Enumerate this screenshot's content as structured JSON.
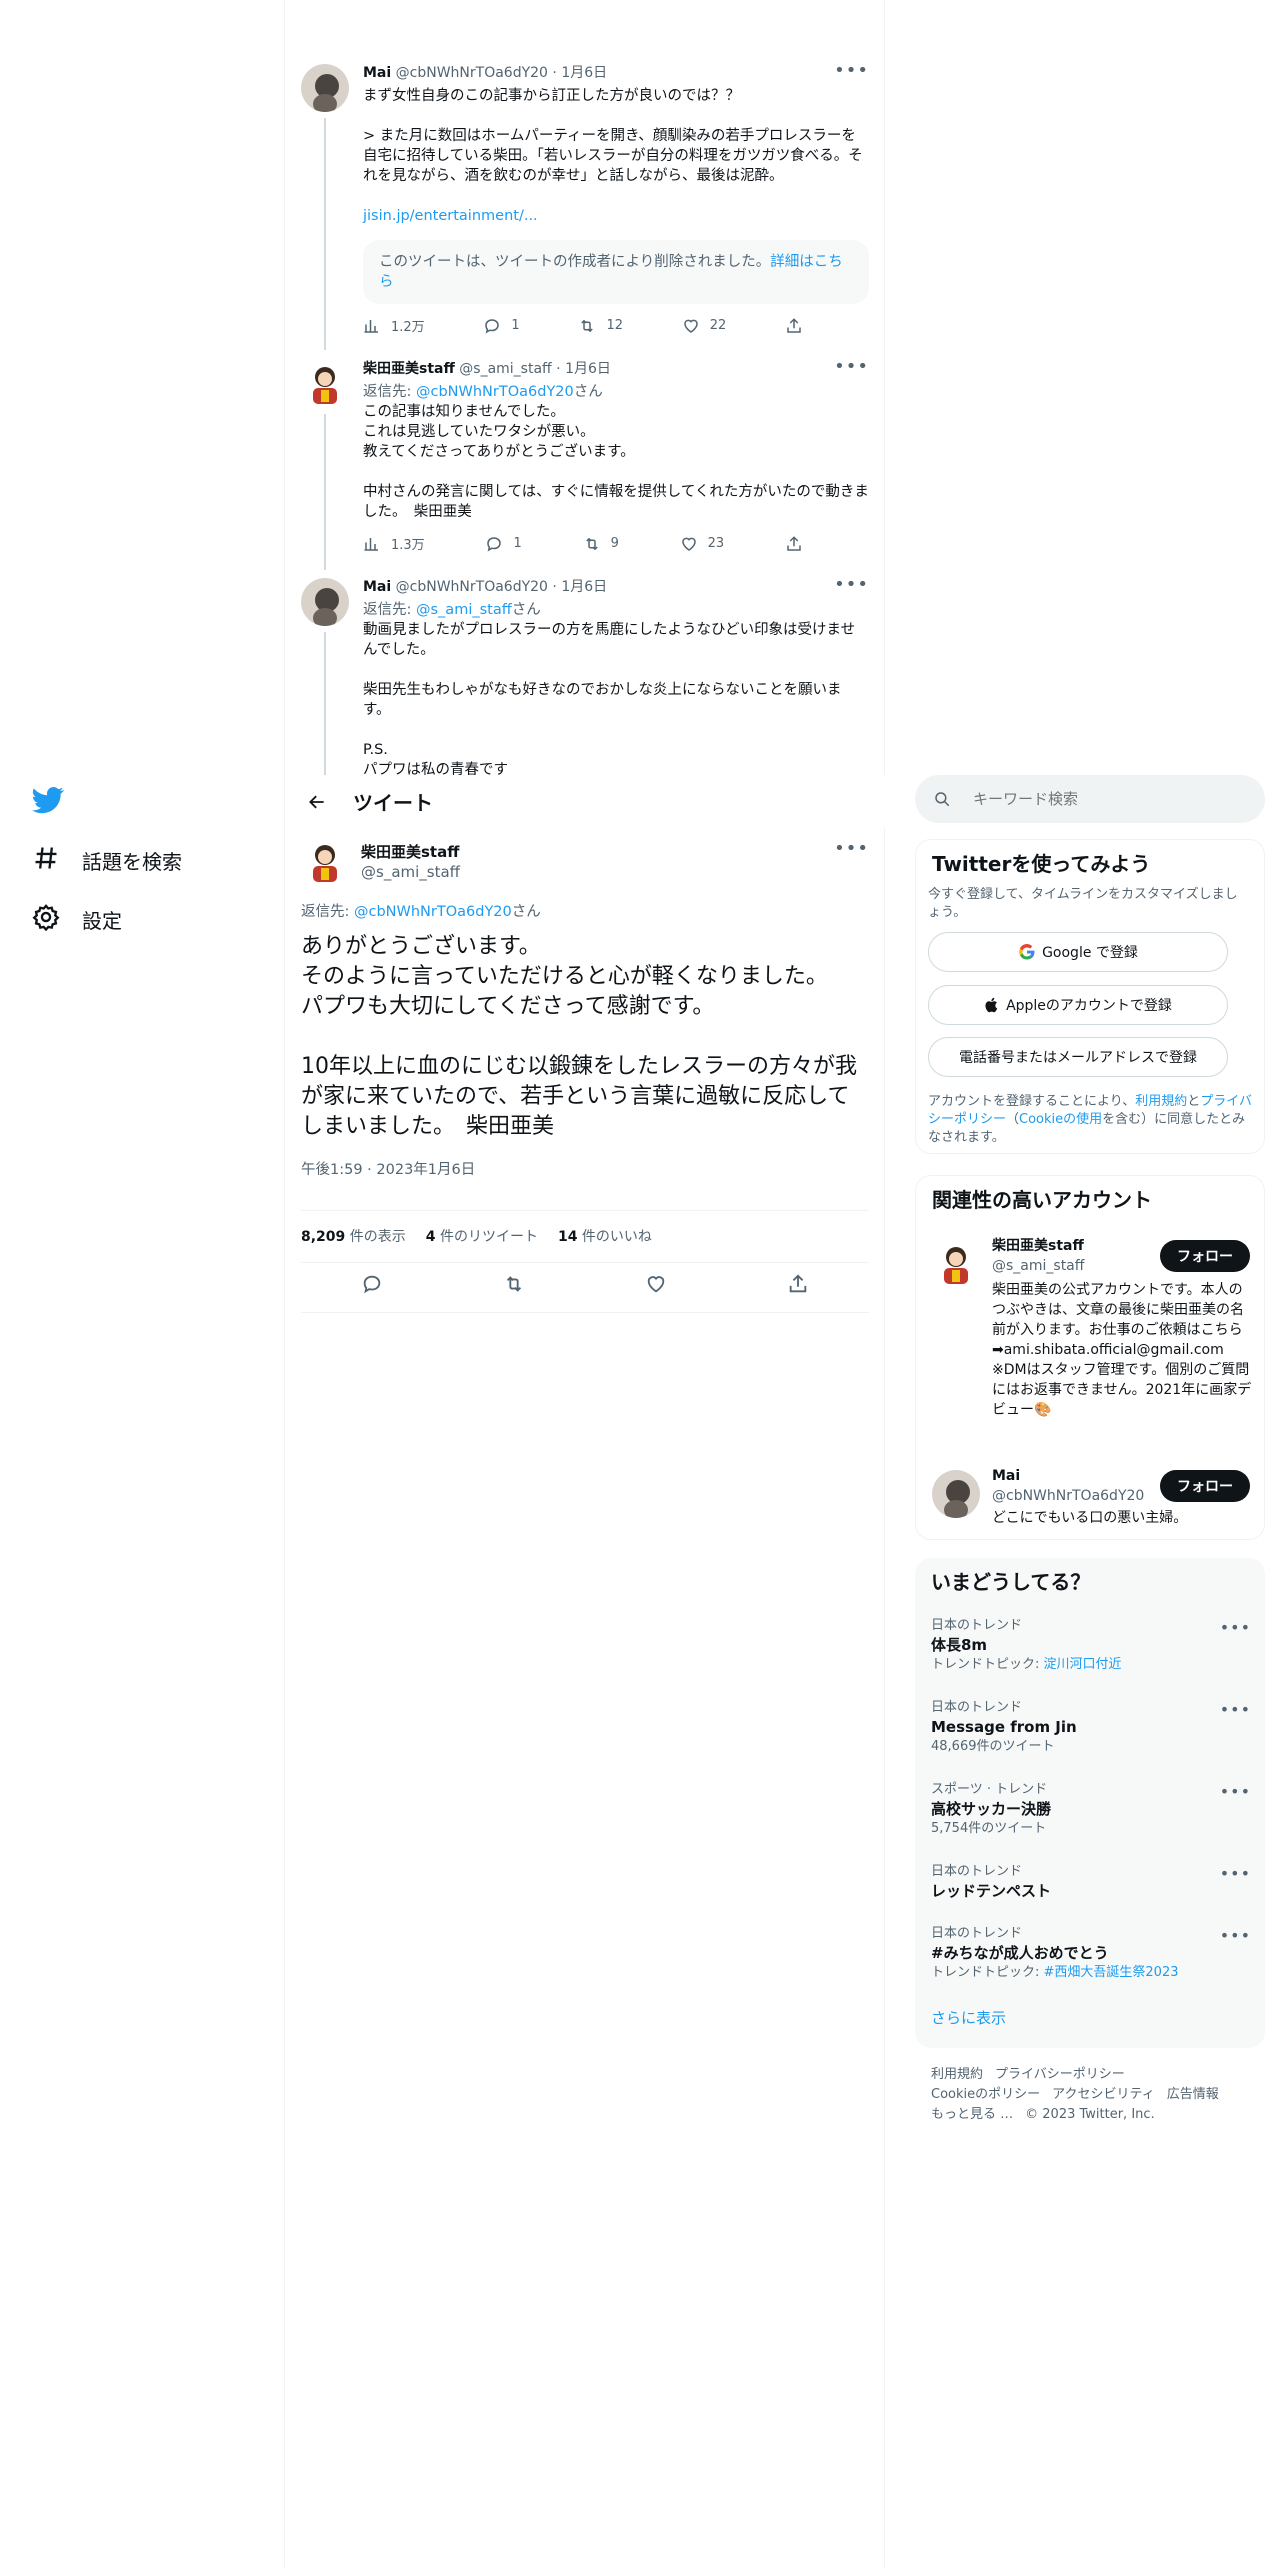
{
  "nav": {
    "items": [
      {
        "icon": "hashtag-icon",
        "label": "話題を検索"
      },
      {
        "icon": "gear-icon",
        "label": "設定"
      }
    ]
  },
  "context": {
    "tweet1": {
      "name": "Mai",
      "handle": "@cbNWhNrTOa6dY20",
      "date": "1月6日",
      "text": "まず女性自身のこの記事から訂正した方が良いのでは？？\n\n> また月に数回はホームパーティーを開き、顔馴染みの若手プロレスラーを自宅に招待している柴田。「若いレスラーが自分の料理をガツガツ食べる。それを見ながら、酒を飲むのが幸せ」と話しながら、最後は泥酔。",
      "link": "jisin.jp/entertainment/...",
      "notice": "このツイートは、ツイートの作成者により削除されました。",
      "notice_link": "詳細はこちら",
      "views": "1.2万",
      "replies": "1",
      "retweets": "12",
      "likes": "22"
    },
    "tweet2": {
      "name": "柴田亜美staff",
      "handle": "@s_ami_staff",
      "date": "1月6日",
      "reply_prefix": "返信先: ",
      "reply_to": "@cbNWhNrTOa6dY20",
      "reply_suffix": "さん",
      "text": "この記事は知りませんでした。\nこれは見逃していたワタシが悪い。\n教えてくださってありがとうございます。\n\n中村さんの発言に関しては、すぐに情報を提供してくれた方がいたので動きました。　柴田亜美",
      "views": "1.3万",
      "replies": "1",
      "retweets": "9",
      "likes": "23"
    },
    "tweet3": {
      "name": "Mai",
      "handle": "@cbNWhNrTOa6dY20",
      "date": "1月6日",
      "reply_prefix": "返信先: ",
      "reply_to": "@s_ami_staff",
      "reply_suffix": "さん",
      "text": "動画見ましたがプロレスラーの方を馬鹿にしたようなひどい印象は受けませんでした。\n\n柴田先生もわしゃがなも好きなのでおかしな炎上にならないことを願います。\n\nP.S.\nパプワは私の青春です"
    }
  },
  "header": {
    "title": "ツイート"
  },
  "main_tweet": {
    "name": "柴田亜美staff",
    "handle": "@s_ami_staff",
    "reply_prefix": "返信先: ",
    "reply_to": "@cbNWhNrTOa6dY20",
    "reply_suffix": "さん",
    "text": "ありがとうございます。\nそのように言っていただけると心が軽くなりました。\nパプワも大切にしてくださって感謝です。\n\n10年以上に血のにじむ以鍛錬をしたレスラーの方々が我が家に来ていたので、若手という言葉に過敏に反応してしまいました。　柴田亜美",
    "timestamp": "午後1:59 · 2023年1月6日",
    "views_count": "8,209",
    "views_label": "件の表示",
    "retweets_count": "4",
    "retweets_label": "件のリツイート",
    "likes_count": "14",
    "likes_label": "件のいいね"
  },
  "search": {
    "placeholder": "キーワード検索"
  },
  "signup": {
    "title": "Twitterを使ってみよう",
    "desc": "今すぐ登録して、タイムラインをカスタマイズしましょう。",
    "google": "Google で登録",
    "apple": "Appleのアカウントで登録",
    "phone": "電話番号またはメールアドレスで登録",
    "terms_1": "アカウントを登録することにより、",
    "terms_link1": "利用規約",
    "terms_2": "と",
    "terms_link2": "プライバシーポリシー",
    "terms_3": "（",
    "terms_link3": "Cookieの使用",
    "terms_4": "を含む）に同意したとみなされます。"
  },
  "related": {
    "title": "関連性の高いアカウント",
    "follow_label": "フォロー",
    "accounts": [
      {
        "name": "柴田亜美staff",
        "handle": "@s_ami_staff",
        "bio": "柴田亜美の公式アカウントです。本人のつぶやきは、文章の最後に柴田亜美の名前が入ります。お仕事のご依頼はこちら\n➡ami.shibata.official@gmail.com\n※DMはスタッフ管理です。個別のご質問にはお返事できません。2021年に画家デビュー🎨"
      },
      {
        "name": "Mai",
        "handle": "@cbNWhNrTOa6dY20",
        "bio": "どこにでもいる口の悪い主婦。"
      }
    ]
  },
  "trends": {
    "title": "いまどうしてる？",
    "items": [
      {
        "category": "日本のトレンド",
        "name": "体長8m",
        "sub_prefix": "トレンドトピック: ",
        "sub_link": "淀川河口付近"
      },
      {
        "category": "日本のトレンド",
        "name": "Message from Jin",
        "sub": "48,669件のツイート"
      },
      {
        "category": "スポーツ · トレンド",
        "name": "高校サッカー決勝",
        "sub": "5,754件のツイート"
      },
      {
        "category": "日本のトレンド",
        "name": "レッドテンペスト"
      },
      {
        "category": "日本のトレンド",
        "name": "#みちなが成人おめでとう",
        "sub_prefix": "トレンドトピック: ",
        "sub_link": "#西畑大吾誕生祭2023"
      }
    ],
    "more": "さらに表示"
  },
  "footer": {
    "line1": [
      "利用規約",
      "プライバシーポリシー"
    ],
    "line2": [
      "Cookieのポリシー",
      "アクセシビリティ",
      "広告情報"
    ],
    "more": "もっと見る …",
    "copyright": "© 2023 Twitter, Inc."
  },
  "colors": {
    "accent": "#1d9bf0",
    "text": "#0f1419",
    "muted": "#536471",
    "border": "#eff3f4",
    "button": "#0f1419"
  }
}
